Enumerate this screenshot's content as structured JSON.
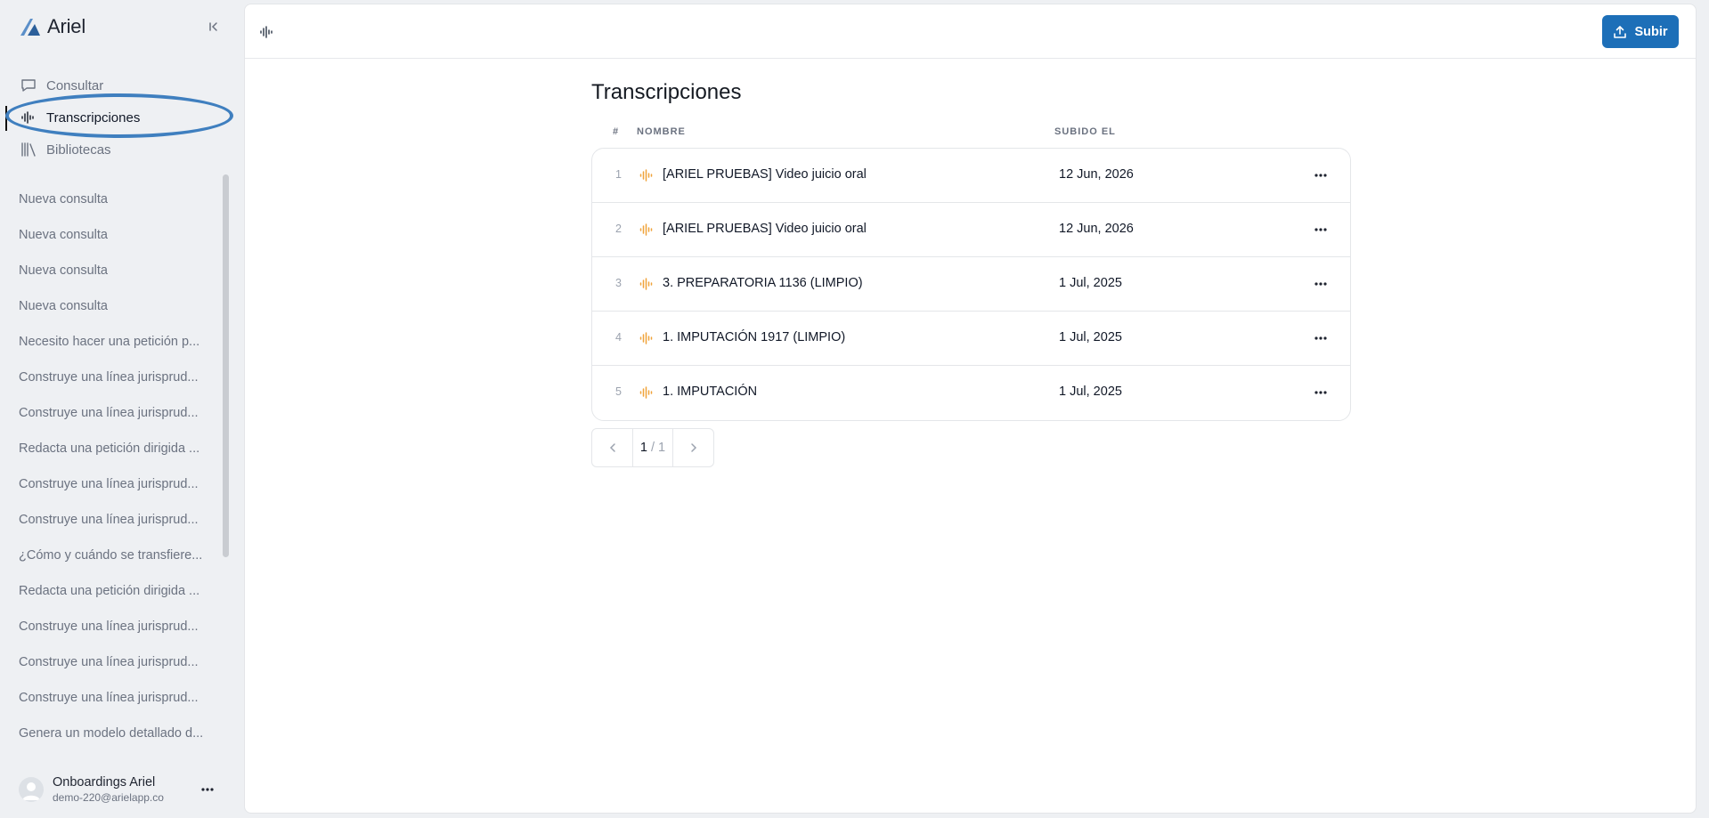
{
  "app": {
    "name": "Ariel"
  },
  "nav": {
    "items": [
      {
        "label": "Consultar",
        "icon": "chat-bubble-icon"
      },
      {
        "label": "Transcripciones",
        "icon": "waveform-icon",
        "active": true
      },
      {
        "label": "Bibliotecas",
        "icon": "library-icon"
      }
    ]
  },
  "history": [
    "Nueva consulta",
    "Nueva consulta",
    "Nueva consulta",
    "Nueva consulta",
    "Necesito hacer una petición p...",
    "Construye una línea jurisprud...",
    "Construye una línea jurisprud...",
    "Redacta una petición dirigida ...",
    "Construye una línea jurisprud...",
    "Construye una línea jurisprud...",
    "¿Cómo y cuándo se transfiere...",
    "Redacta una petición dirigida ...",
    "Construye una línea jurisprud...",
    "Construye una línea jurisprud...",
    "Construye una línea jurisprud...",
    "Genera un modelo detallado d..."
  ],
  "user": {
    "name": "Onboardings Ariel",
    "email": "demo-220@arielapp.co"
  },
  "topbar": {
    "upload_label": "Subir"
  },
  "page": {
    "title": "Transcripciones",
    "columns": {
      "num": "#",
      "name": "NOMBRE",
      "date": "SUBIDO EL"
    },
    "rows": [
      {
        "num": "1",
        "name": "[ARIEL PRUEBAS] Video juicio oral",
        "date": "12 Jun, 2026"
      },
      {
        "num": "2",
        "name": "[ARIEL PRUEBAS] Video juicio oral",
        "date": "12 Jun, 2026"
      },
      {
        "num": "3",
        "name": "3. PREPARATORIA 1136 (LIMPIO)",
        "date": "1 Jul, 2025"
      },
      {
        "num": "4",
        "name": "1. IMPUTACIÓN 1917 (LIMPIO)",
        "date": "1 Jul, 2025"
      },
      {
        "num": "5",
        "name": "1. IMPUTACIÓN",
        "date": "1 Jul, 2025"
      }
    ],
    "pagination": {
      "current": "1",
      "total": "/ 1"
    }
  },
  "colors": {
    "accent": "#1d6fb8",
    "wave": "#f0a33a",
    "highlight": "#3f7fbf"
  }
}
